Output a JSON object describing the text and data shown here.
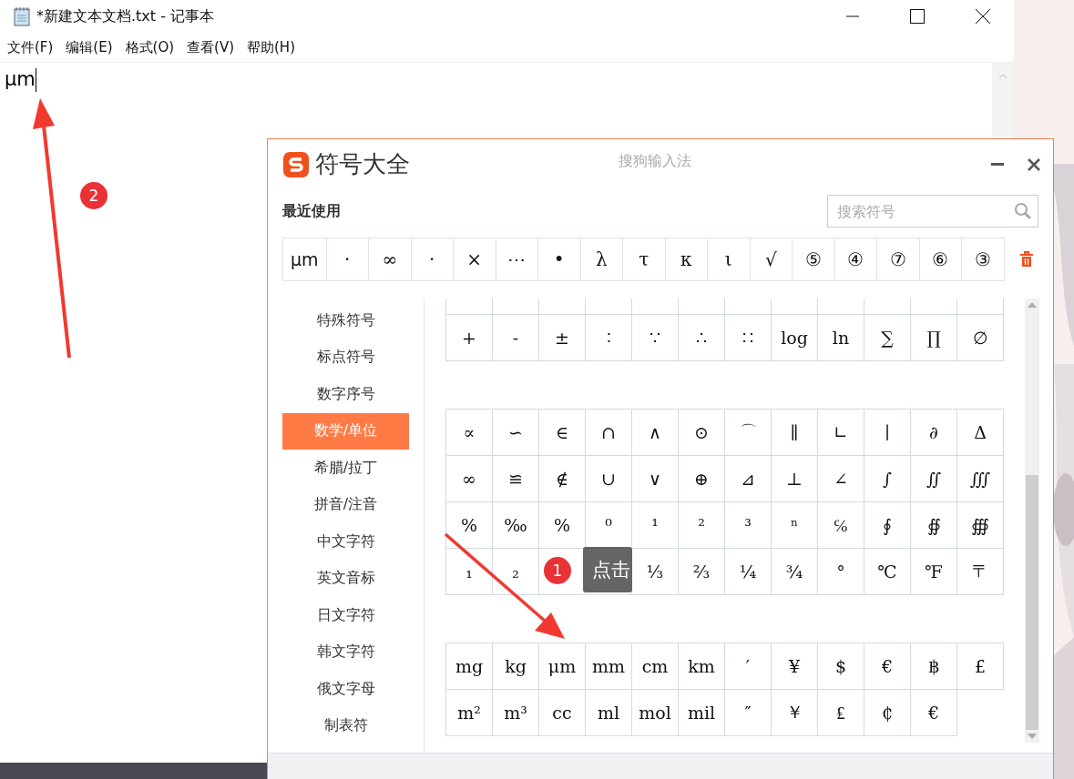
{
  "notepad": {
    "title": "*新建文本文档.txt - 记事本",
    "menu": [
      "文件(F)",
      "编辑(E)",
      "格式(O)",
      "查看(V)",
      "帮助(H)"
    ],
    "text": "μm"
  },
  "symbol_panel": {
    "title": "符号大全",
    "subtitle": "搜狗输入法",
    "recent_label": "最近使用",
    "search": {
      "placeholder": "搜索符号"
    },
    "recent": [
      "μm",
      "·",
      "∞",
      "·",
      "×",
      "⋯",
      "•",
      "λ",
      "τ",
      "κ",
      "ι",
      "√",
      "⑤",
      "④",
      "⑦",
      "⑥",
      "③"
    ],
    "categories": [
      {
        "label": "特殊符号",
        "selected": false
      },
      {
        "label": "标点符号",
        "selected": false
      },
      {
        "label": "数字序号",
        "selected": false
      },
      {
        "label": "数学/单位",
        "selected": true
      },
      {
        "label": "希腊/拉丁",
        "selected": false
      },
      {
        "label": "拼音/注音",
        "selected": false
      },
      {
        "label": "中文字符",
        "selected": false
      },
      {
        "label": "英文音标",
        "selected": false
      },
      {
        "label": "日文字符",
        "selected": false
      },
      {
        "label": "韩文字符",
        "selected": false
      },
      {
        "label": "俄文字母",
        "selected": false
      },
      {
        "label": "制表符",
        "selected": false
      }
    ],
    "sections": [
      {
        "rows": [
          [
            "+",
            "-",
            "±",
            "∶",
            "∵",
            "∴",
            "∷",
            "log",
            "ln",
            "∑",
            "∏",
            "∅"
          ]
        ]
      },
      {
        "rows": [
          [
            "∝",
            "∽",
            "∈",
            "∩",
            "∧",
            "⊙",
            "⌒",
            "∥",
            "∟",
            "∣",
            "∂",
            "Δ"
          ],
          [
            "∞",
            "≌",
            "∉",
            "∪",
            "∨",
            "⊕",
            "⊿",
            "⊥",
            "∠",
            "∫",
            "∬",
            "∭"
          ],
          [
            "%",
            "‰",
            "%",
            "⁰",
            "¹",
            "²",
            "³",
            "ⁿ",
            "℅",
            "∮",
            "∯",
            "∰"
          ],
          [
            "₁",
            "₂",
            null,
            null,
            "⅓",
            "⅔",
            "¼",
            "¾",
            "°",
            "℃",
            "℉",
            "〒"
          ]
        ]
      },
      {
        "rows": [
          [
            "mg",
            "kg",
            "μm",
            "mm",
            "cm",
            "km",
            "′",
            "¥",
            "$",
            "€",
            "฿",
            "£"
          ],
          [
            "m²",
            "m³",
            "cc",
            "ml",
            "mol",
            "mil",
            "″",
            "￥",
            "₤",
            "₵",
            "€"
          ]
        ]
      }
    ]
  },
  "annotations": {
    "badges": [
      "2",
      "1"
    ],
    "tooltip": "点击"
  }
}
